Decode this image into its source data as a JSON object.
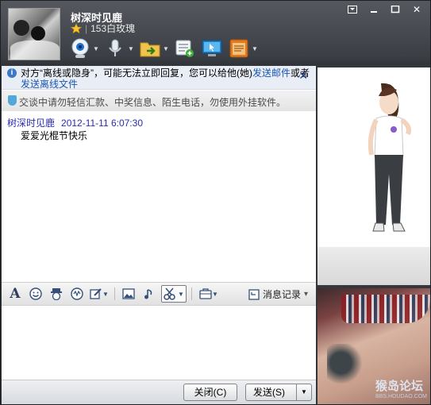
{
  "window": {
    "controls": [
      "menu-icon",
      "minimize-icon",
      "maximize-icon",
      "close-icon"
    ],
    "close_glyph": "✕"
  },
  "contact": {
    "name": "树深时见鹿",
    "roses": "153白玫瑰",
    "separator": "|"
  },
  "toolbar": {
    "items": [
      {
        "name": "video-call-icon"
      },
      {
        "name": "voice-call-icon"
      },
      {
        "name": "send-file-icon"
      },
      {
        "name": "group-chat-icon"
      },
      {
        "name": "remote-assist-icon"
      },
      {
        "name": "app-box-icon"
      }
    ]
  },
  "notice": {
    "info_glyph": "i",
    "text_part1": "对方“离线或隐身”，可能无法立即回复，您可以给他(她)",
    "link1": "发送邮件",
    "text_part2": "或者",
    "link2": "发送离线文件",
    "close_glyph": "✕"
  },
  "security": {
    "text": "交谈中请勿轻信汇款、中奖信息、陌生电话，勿使用外挂软件。"
  },
  "messages": [
    {
      "sender": "树深时见鹿",
      "time": "2012-11-11 6:07:30",
      "text": "爱爱光棍节快乐"
    }
  ],
  "format_bar": {
    "font_glyph": "A",
    "history_label": "消息记录",
    "dropdown_glyph": "▾"
  },
  "buttons": {
    "close_label": "关闭(C)",
    "send_label": "发送(S)",
    "send_dropdown": "▼"
  },
  "ad": {
    "brand": "猴岛论坛",
    "site": "BBS.HOUDAO.COM"
  },
  "colors": {
    "header_bg": "#3b3f45",
    "link": "#1a57b5",
    "sender": "#2b2bb0"
  }
}
